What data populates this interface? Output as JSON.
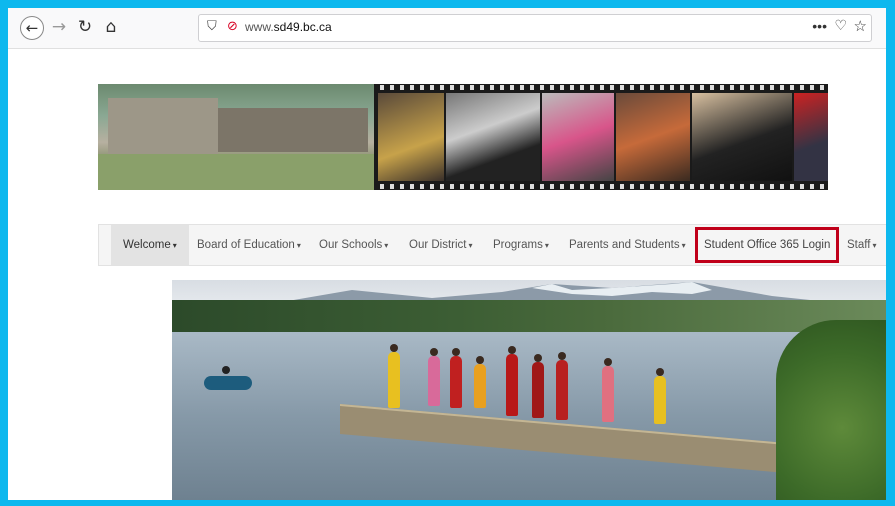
{
  "browser": {
    "url_prefix": "www.",
    "url_domain": "sd49.bc.ca",
    "more_label": "•••"
  },
  "menu": {
    "items": [
      {
        "label": "Welcome",
        "caret": true
      },
      {
        "label": "Board of Education",
        "caret": true
      },
      {
        "label": "Our Schools",
        "caret": true
      },
      {
        "label": "Our District",
        "caret": true
      },
      {
        "label": "Programs",
        "caret": true
      },
      {
        "label": "Parents and Students",
        "caret": true
      },
      {
        "label": "Student Office 365 Login",
        "caret": false
      },
      {
        "label": "Staff",
        "caret": true
      }
    ]
  },
  "colors": {
    "frame_border": "#0db8ee",
    "highlight_box": "#c0001a"
  },
  "icons": [
    "back-icon",
    "forward-icon",
    "reload-icon",
    "home-icon",
    "shield-icon",
    "insecure-lock-icon",
    "more-icon",
    "pocket-icon",
    "star-icon"
  ]
}
